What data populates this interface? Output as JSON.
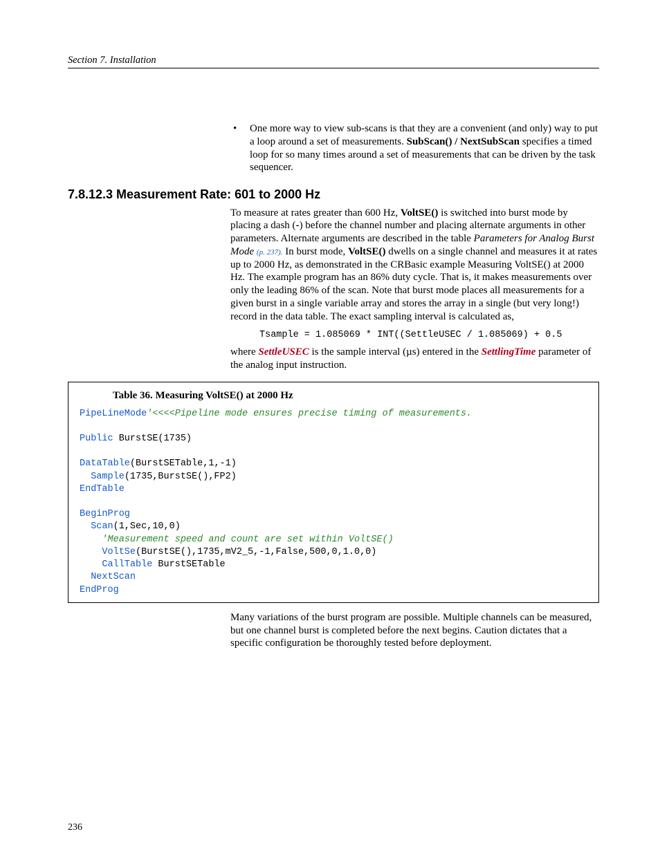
{
  "header": {
    "section": "Section 7.  Installation"
  },
  "bullet": {
    "text_a": "One more way to view sub-scans is that they are a convenient (and only) way to put a loop around a set of measurements.  ",
    "bold": "SubScan() / NextSubScan",
    "text_b": " specifies a timed loop for so many times around a set of measurements that can be driven by the task sequencer."
  },
  "heading": "7.8.12.3 Measurement Rate: 601 to 2000 Hz",
  "para1": {
    "a": "To measure at rates greater than 600 Hz, ",
    "b": "VoltSE()",
    "c": " is switched into burst mode by placing a dash (",
    "d": "-",
    "e": ") before the channel number and placing alternate arguments in other parameters.  Alternate arguments are described in the table ",
    "f": "Parameters for Analog Burst Mode ",
    "g": "(p. 237).",
    "h": "  In burst mode, ",
    "i": "VoltSE()",
    "j": " dwells on a single channel and measures it at rates up to 2000 Hz, as demonstrated in the CRBasic example Measuring VoltSE() at 2000 Hz",
    "k": "  The example program has an 86% duty cycle.  That is, it makes measurements over only the leading 86% of the scan.  Note that burst mode places all measurements for a given burst in a single variable array and stores the array in a single (but very long!) record in the data table.  The exact sampling interval is calculated as,"
  },
  "formula": "Tsample = 1.085069 * INT((SettleUSEC / 1.085069) + 0.5",
  "para2": {
    "a": "where ",
    "b": "SettleUSEC",
    "c": " is the sample interval (µs) entered in the ",
    "d": "SettlingTime",
    "e": " parameter of the analog input instruction."
  },
  "table_caption": "Table 36. Measuring VoltSE() at 2000 Hz",
  "code": {
    "l1a": "PipeLineMode",
    "l1b": "'<<<<Pipeline mode ensures precise timing of measurements.",
    "l3a": "Public",
    "l3b": " BurstSE(1735)",
    "l5a": "DataTable",
    "l5b": "(BurstSETable,1,-1)",
    "l6a": "  Sample",
    "l6b": "(1735,BurstSE(),FP2)",
    "l7": "EndTable",
    "l9": "BeginProg",
    "l10a": "  Scan",
    "l10b": "(1,Sec,10,0)",
    "l11a": "    '",
    "l11b": "Measurement speed and count are set within VoltSE()",
    "l12a": "    VoltSe",
    "l12b": "(BurstSE(),1735,mV2_5,-1,False,500,0,1.0,0)",
    "l13a": "    CallTable",
    "l13b": " BurstSETable",
    "l14": "  NextScan",
    "l15": "EndProg"
  },
  "para3": "Many variations of the burst program are possible.  Multiple channels can be measured, but one channel burst is completed before the next begins.  Caution dictates that a specific configuration be thoroughly tested before deployment.",
  "page_number": "236"
}
